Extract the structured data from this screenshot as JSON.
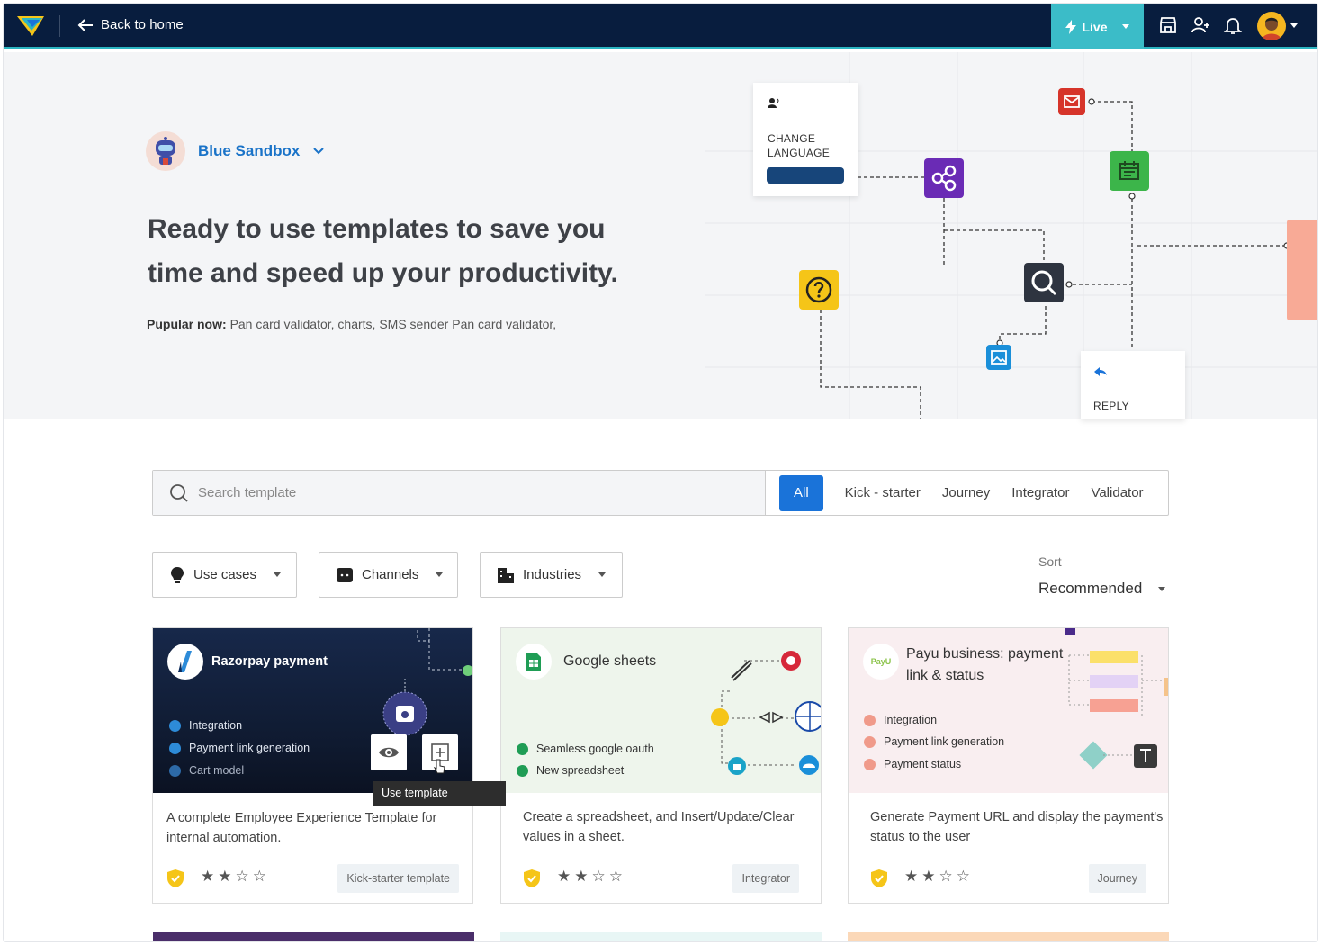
{
  "topbar": {
    "back_label": "Back to home",
    "live_label": "Live",
    "icons": [
      "store-icon",
      "user-add-icon",
      "bell-icon"
    ]
  },
  "hero": {
    "workspace": "Blue Sandbox",
    "headline": "Ready to use templates to save you time and speed up your productivity.",
    "popular_label": "Pupular now:",
    "popular_items": "Pan card validator, charts, SMS sender Pan card validator,",
    "diagram": {
      "change_language": "CHANGE LANGUAGE",
      "reply": "REPLY"
    }
  },
  "search": {
    "placeholder": "Search template",
    "tabs": [
      "All",
      "Kick - starter",
      "Journey",
      "Integrator",
      "Validator"
    ]
  },
  "filters": {
    "use_cases": "Use cases",
    "channels": "Channels",
    "industries": "Industries",
    "sort_label": "Sort",
    "sort_value": "Recommended"
  },
  "cards": [
    {
      "title": "Razorpay payment",
      "features": [
        "Integration",
        "Payment link generation",
        "Cart model"
      ],
      "tooltip": "Use template",
      "description": "A complete Employee Experience Template for internal automation.",
      "tag": "Kick-starter template",
      "rating": 2
    },
    {
      "title": "Google sheets",
      "features": [
        "Seamless google oauth",
        "New spreadsheet"
      ],
      "description": "Create a spreadsheet, and Insert/Update/Clear values in a sheet.",
      "tag": "Integrator",
      "rating": 2
    },
    {
      "title": "Payu business: payment link & status",
      "logo_text": "PayU",
      "features": [
        "Integration",
        "Payment link generation",
        "Payment status"
      ],
      "description": "Generate Payment URL and display the payment's status to the user",
      "tag": "Journey",
      "rating": 2
    }
  ]
}
